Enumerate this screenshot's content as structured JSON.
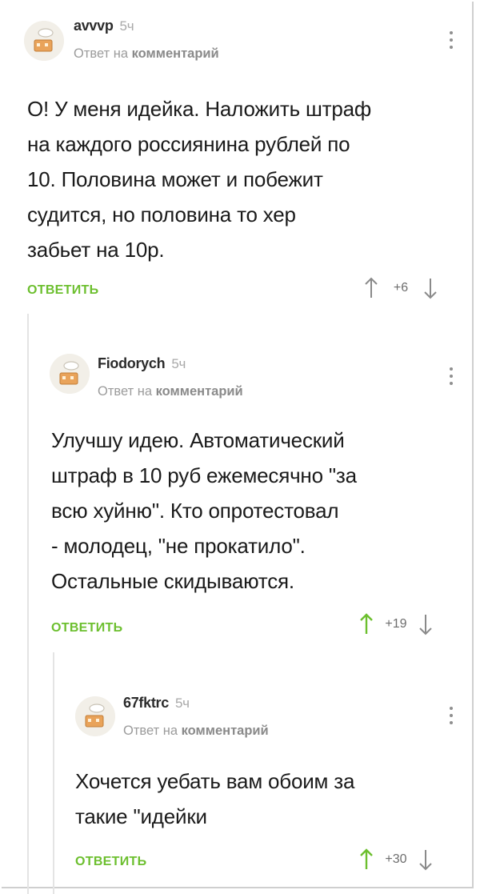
{
  "comments": [
    {
      "author": "avvvp",
      "age": "5ч",
      "reply_prefix": "Ответ на",
      "reply_target": "комментарий",
      "lines": [
        "О! У меня идейка. Наложить штраф",
        "на каждого россиянина рублей по",
        "10. Половина может и побежит",
        "судится, но половина то хер",
        "забьет на 10р."
      ],
      "reply_label": "ОТВЕТИТЬ",
      "rating": "+6",
      "upvoted": false
    },
    {
      "author": "Fiodorych",
      "age": "5ч",
      "reply_prefix": "Ответ на",
      "reply_target": "комментарий",
      "lines": [
        "Улучшу идею. Автоматический",
        "штраф в 10 руб ежемесячно \"за",
        "всю хуйню\". Кто опротестовал",
        "- молодец, \"не прокатило\".",
        "Остальные скидываются."
      ],
      "reply_label": "ОТВЕТИТЬ",
      "rating": "+19",
      "upvoted": true
    },
    {
      "author": "67fktrc",
      "age": "5ч",
      "reply_prefix": "Ответ на",
      "reply_target": "комментарий",
      "lines": [
        "Хочется уебать вам обоим за",
        "такие \"идейки"
      ],
      "reply_label": "ОТВЕТИТЬ",
      "rating": "+30",
      "upvoted": true
    }
  ],
  "colors": {
    "accent_green": "#6cbf2e",
    "muted_gray": "#a9a9a9",
    "arrow_gray": "#8a8a8a"
  },
  "icons": {
    "avatar": "default-avatar-icon",
    "menu": "more-vertical-icon",
    "upvote": "arrow-up-icon",
    "downvote": "arrow-down-icon"
  }
}
